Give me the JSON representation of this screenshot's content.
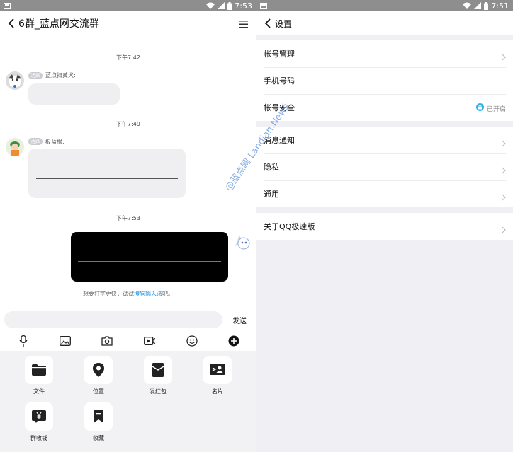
{
  "left": {
    "status": {
      "time": "7:53"
    },
    "header": {
      "title": "6群_蓝点网交流群"
    },
    "chat": {
      "messages": [
        {
          "time": "下午7:42",
          "badge": "活跃",
          "sender": "蓝点扫黄犬:"
        },
        {
          "time": "下午7:49",
          "badge": "活跃",
          "sender": "板蓝根:"
        },
        {
          "time": "下午7:53"
        }
      ],
      "hint": {
        "prefix": "想要打字更快，试试",
        "link": "搜狗输入法",
        "suffix": "吧。"
      }
    },
    "input": {
      "send_label": "发送"
    },
    "toolbar": {
      "icons": [
        "microphone-icon",
        "image-icon",
        "camera-icon",
        "video-icon",
        "emoji-icon",
        "plus-icon"
      ]
    },
    "panel": {
      "items": [
        {
          "label": "文件",
          "icon": "folder-icon"
        },
        {
          "label": "位置",
          "icon": "location-icon"
        },
        {
          "label": "发红包",
          "icon": "red-envelope-icon"
        },
        {
          "label": "名片",
          "icon": "contact-card-icon"
        },
        {
          "label": "群收钱",
          "icon": "yuan-icon"
        },
        {
          "label": "收藏",
          "icon": "bookmark-icon"
        }
      ]
    }
  },
  "right": {
    "status": {
      "time": "7:51"
    },
    "header": {
      "title": "设置"
    },
    "groups": [
      [
        {
          "label": "帐号管理"
        },
        {
          "label": "手机号码"
        },
        {
          "label": "帐号安全",
          "value": "已开启"
        }
      ],
      [
        {
          "label": "消息通知"
        },
        {
          "label": "隐私"
        },
        {
          "label": "通用"
        }
      ],
      [
        {
          "label": "关于QQ极速版"
        }
      ]
    ]
  },
  "watermark": {
    "text": "@蓝点网 Landian.News"
  },
  "colors": {
    "link": "#1d8fe1",
    "status_bar": "#8e8e8e",
    "bubble": "#efeff1"
  }
}
